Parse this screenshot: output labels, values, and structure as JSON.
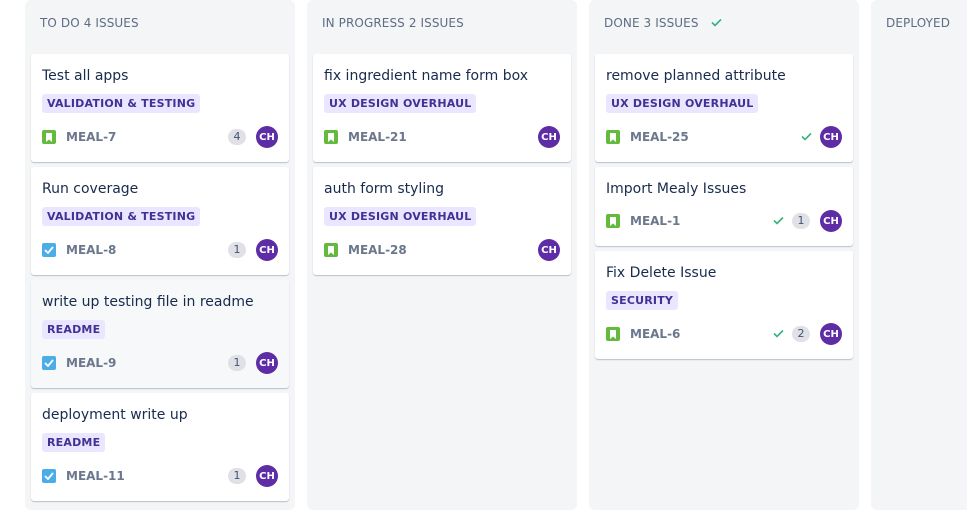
{
  "columns": [
    {
      "title": "To Do 4 issues",
      "cards": [
        {
          "title": "Test all apps",
          "label": "VALIDATION & TESTING",
          "type": "story",
          "key": "MEAL-7",
          "done": false,
          "count": "4",
          "assignee": "CH"
        },
        {
          "title": "Run coverage",
          "label": "VALIDATION & TESTING",
          "type": "task",
          "key": "MEAL-8",
          "done": false,
          "count": "1",
          "assignee": "CH"
        },
        {
          "title": "write up testing file in readme",
          "label": "README",
          "type": "task",
          "key": "MEAL-9",
          "done": false,
          "count": "1",
          "assignee": "CH"
        },
        {
          "title": "deployment write up",
          "label": "README",
          "type": "task",
          "key": "MEAL-11",
          "done": false,
          "count": "1",
          "assignee": "CH"
        }
      ]
    },
    {
      "title": "In Progress 2 issues",
      "cards": [
        {
          "title": "fix ingredient name form box",
          "label": "UX DESIGN OVERHAUL",
          "type": "story",
          "key": "MEAL-21",
          "done": false,
          "count": "",
          "assignee": "CH"
        },
        {
          "title": "auth form styling",
          "label": "UX DESIGN OVERHAUL",
          "type": "story",
          "key": "MEAL-28",
          "done": false,
          "count": "",
          "assignee": "CH"
        }
      ]
    },
    {
      "title": "Done 3 issues",
      "cards": [
        {
          "title": "remove planned attribute",
          "label": "UX DESIGN OVERHAUL",
          "type": "story",
          "key": "MEAL-25",
          "done": true,
          "count": "",
          "assignee": "CH"
        },
        {
          "title": "Import Mealy Issues",
          "label": "",
          "type": "story",
          "key": "MEAL-1",
          "done": true,
          "count": "1",
          "assignee": "CH"
        },
        {
          "title": "Fix Delete Issue",
          "label": "SECURITY",
          "type": "story",
          "key": "MEAL-6",
          "done": true,
          "count": "2",
          "assignee": "CH"
        }
      ]
    },
    {
      "title": "Deployed",
      "cards": []
    }
  ],
  "colors": {
    "column_bg": "#f4f5f7",
    "label_bg": "#eae6ff",
    "label_text": "#403294",
    "story_icon": "#63ba3c",
    "task_icon": "#4bade8",
    "avatar_bg": "#5e2ca5",
    "done_check": "#36b37e"
  },
  "icons": {
    "story": "bookmark-icon",
    "task": "checkbox-icon",
    "done": "checkmark-icon"
  }
}
